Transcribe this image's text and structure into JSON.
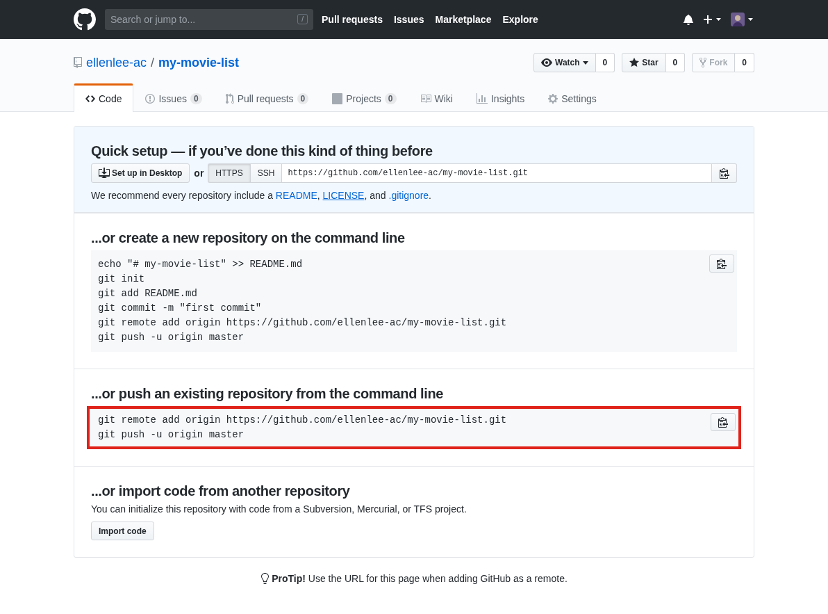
{
  "header": {
    "search_placeholder": "Search or jump to...",
    "slash_key": "/",
    "nav": [
      "Pull requests",
      "Issues",
      "Marketplace",
      "Explore"
    ]
  },
  "repo": {
    "owner": "ellenlee-ac",
    "separator": "/",
    "name": "my-movie-list",
    "actions": [
      {
        "kind": "watch",
        "label": "Watch",
        "count": "0",
        "disabled": false
      },
      {
        "kind": "star",
        "label": "Star",
        "count": "0",
        "disabled": false
      },
      {
        "kind": "fork",
        "label": "Fork",
        "count": "0",
        "disabled": true
      }
    ]
  },
  "tabs": [
    {
      "kind": "code",
      "label": "Code",
      "selected": true
    },
    {
      "kind": "issues",
      "label": "Issues",
      "count": "0",
      "selected": false
    },
    {
      "kind": "pulls",
      "label": "Pull requests",
      "count": "0",
      "selected": false
    },
    {
      "kind": "projects",
      "label": "Projects",
      "count": "0",
      "selected": false
    },
    {
      "kind": "wiki",
      "label": "Wiki",
      "selected": false
    },
    {
      "kind": "insights",
      "label": "Insights",
      "selected": false
    },
    {
      "kind": "settings",
      "label": "Settings",
      "selected": false
    }
  ],
  "quick_setup": {
    "title": "Quick setup — if you’ve done this kind of thing before",
    "desktop_button": "Set up in Desktop",
    "or_text": "or",
    "protocols": [
      {
        "label": "HTTPS",
        "selected": true
      },
      {
        "label": "SSH",
        "selected": false
      }
    ],
    "url": "https://github.com/ellenlee-ac/my-movie-list.git",
    "recommend": [
      {
        "kind": "text",
        "text": "We recommend every repository include a "
      },
      {
        "kind": "link",
        "text": "README",
        "underlined": false
      },
      {
        "kind": "text",
        "text": ", "
      },
      {
        "kind": "link",
        "text": "LICENSE",
        "underlined": true
      },
      {
        "kind": "text",
        "text": ", and "
      },
      {
        "kind": "link",
        "text": ".gitignore",
        "underlined": false
      },
      {
        "kind": "text",
        "text": "."
      }
    ]
  },
  "sections": [
    {
      "title": "...or create a new repository on the command line",
      "highlighted": false,
      "code_lines": [
        "echo \"# my-movie-list\" >> README.md",
        "git init",
        "git add README.md",
        "git commit -m \"first commit\"",
        "git remote add origin https://github.com/ellenlee-ac/my-movie-list.git",
        "git push -u origin master"
      ]
    },
    {
      "title": "...or push an existing repository from the command line",
      "highlighted": true,
      "code_lines": [
        "git remote add origin https://github.com/ellenlee-ac/my-movie-list.git",
        "git push -u origin master"
      ]
    },
    {
      "title": "...or import code from another repository",
      "description": "You can initialize this repository with code from a Subversion, Mercurial, or TFS project.",
      "button": "Import code"
    }
  ],
  "protip": "**ProTip!** Use the URL for this page when adding GitHub as a remote."
}
